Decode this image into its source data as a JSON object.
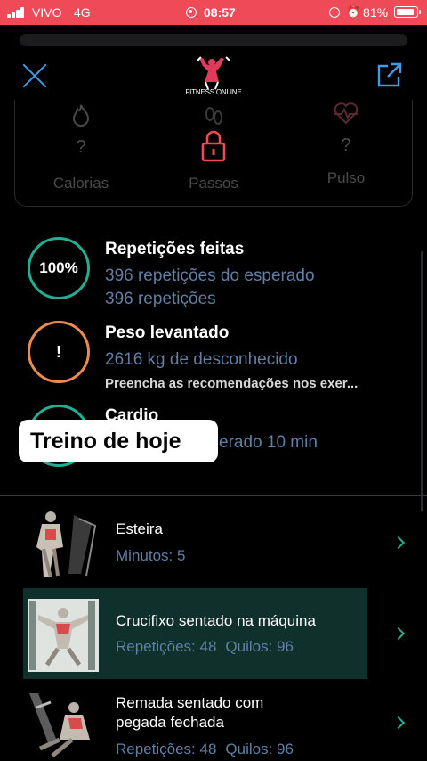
{
  "status_bar": {
    "carrier": "VIVO",
    "network": "4G",
    "time": "08:57",
    "battery": "81%",
    "battery_level": 0.81
  },
  "header": {
    "logo_text": "FITNESS ONLINE",
    "close_icon": "close-icon",
    "share_icon": "share-icon"
  },
  "stats": [
    {
      "icon": "flame-icon",
      "value": "?",
      "label": "Calorias"
    },
    {
      "icon": "lock-icon",
      "label": "Passos"
    },
    {
      "icon": "heart-pulse-icon",
      "value": "?",
      "label": "Pulso"
    }
  ],
  "progress": {
    "reps": {
      "ring": "100%",
      "title": "Repetições feitas",
      "line1": "396 repetições do esperado",
      "line2": "396 repetições"
    },
    "weight": {
      "ring": "!",
      "title": "Peso levantado",
      "line1": "2616 kg de desconhecido",
      "note": "Preencha as recomendações nos exer..."
    },
    "cardio": {
      "title": "Cardio",
      "line1": "erado 10 min"
    }
  },
  "toast": "Treino de hoje",
  "exercises": [
    {
      "name": "Esteira",
      "meta": [
        "Minutos: 5"
      ]
    },
    {
      "name": "Crucifixo sentado na máquina",
      "meta": [
        "Repetições: 48",
        "Quilos: 96"
      ],
      "selected": true
    },
    {
      "name_line1": "Remada sentado com",
      "name_line2": "pegada fechada",
      "meta": [
        "Repetições: 48",
        "Quilos: 96"
      ]
    }
  ],
  "colors": {
    "accent": "#23ad95",
    "warning": "#ed8a4e",
    "status_bar": "#ee4a58",
    "link": "#3f9be3",
    "selected_row": "#10302c"
  }
}
